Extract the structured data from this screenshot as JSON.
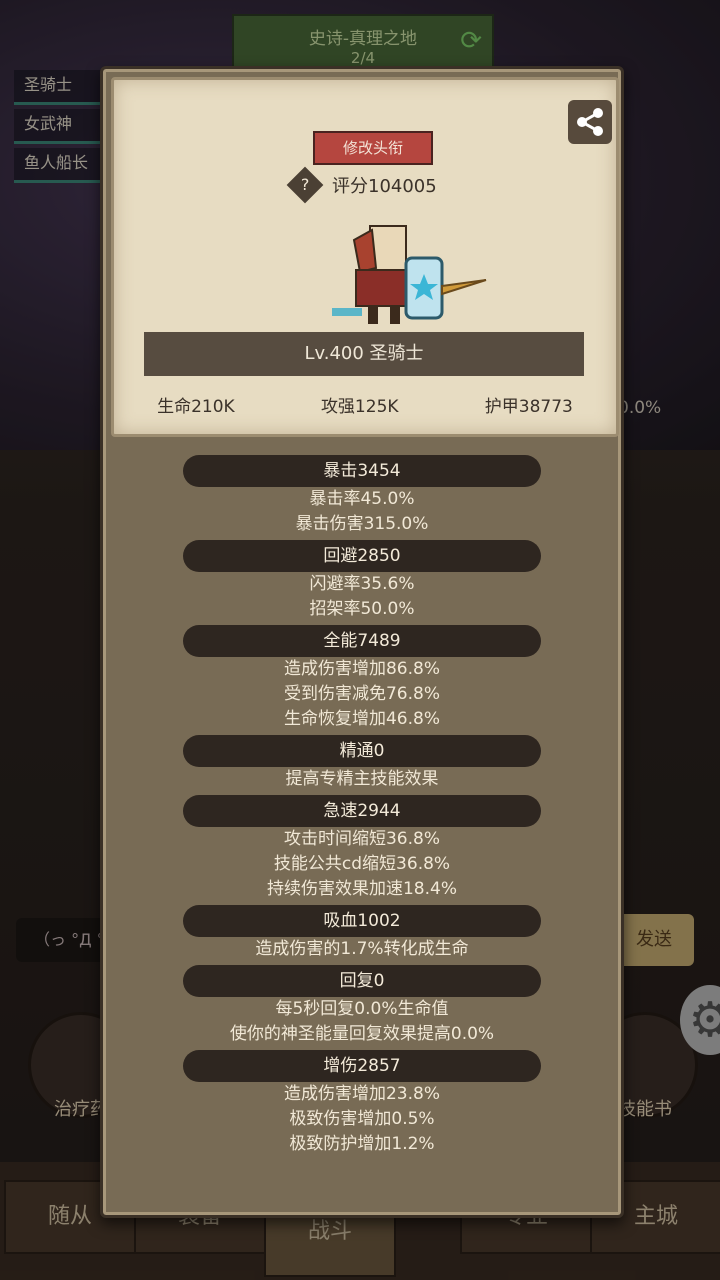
{
  "background": {
    "stage_title": "史诗-真理之地",
    "stage_progress": "2/4",
    "party": [
      "圣骑士",
      "女武神",
      "鱼人船长"
    ],
    "percent_label": "0.0%",
    "chat_placeholder": "（っ °Д °",
    "send_label": "发送",
    "left_button": "治疗药",
    "right_button": "技能书",
    "tabs": [
      "随从",
      "装备",
      "战斗",
      "专业",
      "主城"
    ]
  },
  "panel": {
    "edit_title_label": "修改头衔",
    "score_label": "评分104005",
    "level_label": "Lv.400 圣骑士",
    "stats": [
      "生命210K",
      "攻强125K",
      "护甲38773"
    ],
    "attributes": [
      {
        "header": "暴击3454",
        "lines": [
          "暴击率45.0%",
          "暴击伤害315.0%"
        ]
      },
      {
        "header": "回避2850",
        "lines": [
          "闪避率35.6%",
          "招架率50.0%"
        ]
      },
      {
        "header": "全能7489",
        "lines": [
          "造成伤害增加86.8%",
          "受到伤害减免76.8%",
          "生命恢复增加46.8%"
        ]
      },
      {
        "header": "精通0",
        "lines": [
          "提高专精主技能效果"
        ]
      },
      {
        "header": "急速2944",
        "lines": [
          "攻击时间缩短36.8%",
          "技能公共cd缩短36.8%",
          "持续伤害效果加速18.4%"
        ]
      },
      {
        "header": "吸血1002",
        "lines": [
          "造成伤害的1.7%转化成生命"
        ]
      },
      {
        "header": "回复0",
        "lines": [
          "每5秒回复0.0%生命值",
          "使你的神圣能量回复效果提高0.0%"
        ]
      },
      {
        "header": "增伤2857",
        "lines": [
          "造成伤害增加23.8%",
          "极致伤害增加0.5%",
          "极致防护增加1.2%"
        ]
      }
    ]
  }
}
